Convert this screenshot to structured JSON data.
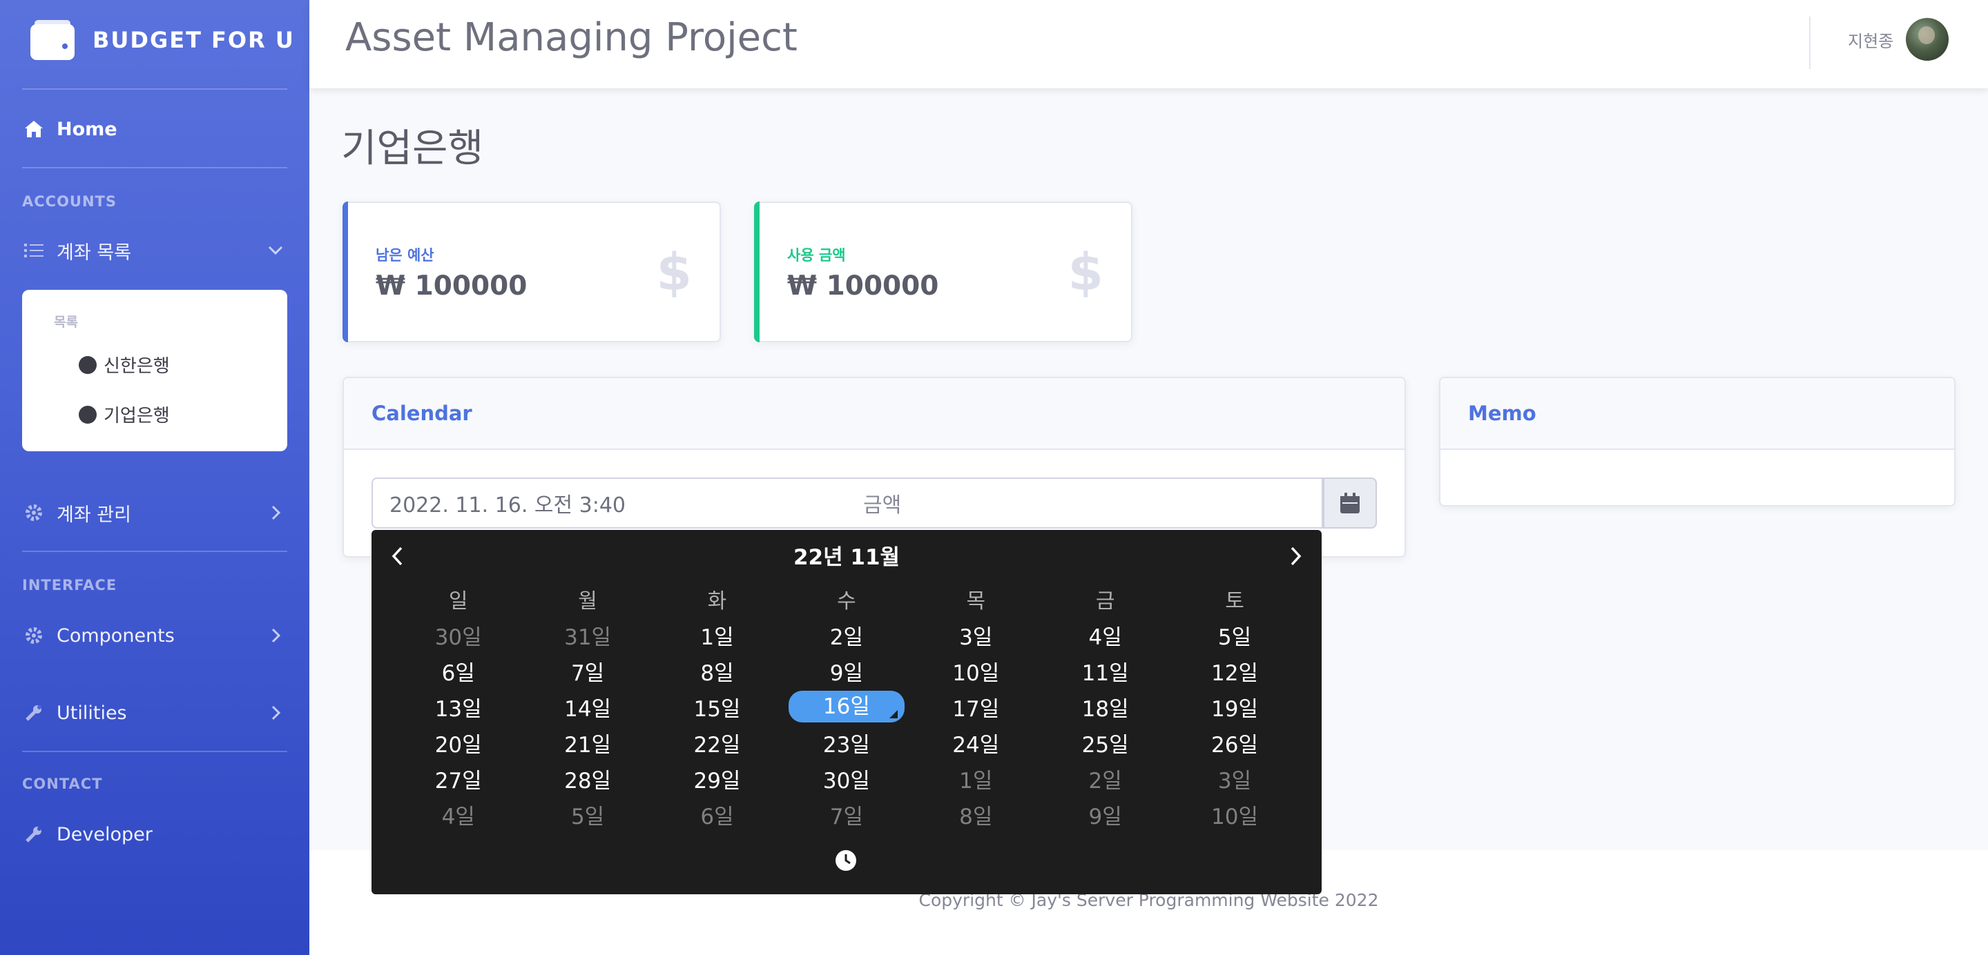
{
  "brand": {
    "name": "BUDGET FOR U"
  },
  "sidebar": {
    "home": "Home",
    "heading_accounts": "ACCOUNTS",
    "account_list": "계좌 목록",
    "submenu": {
      "header": "목록",
      "items": [
        "신한은행",
        "기업은행"
      ]
    },
    "account_manage": "계좌 관리",
    "heading_interface": "INTERFACE",
    "components": "Components",
    "utilities": "Utilities",
    "heading_contact": "CONTACT",
    "developer": "Developer"
  },
  "topbar": {
    "title": "Asset Managing Project",
    "user": "지현종"
  },
  "page": {
    "title": "기업은행"
  },
  "cards": [
    {
      "label": "남은 예산",
      "value": "₩ 100000",
      "color": "#4e73df",
      "icon": "$"
    },
    {
      "label": "사용 금액",
      "value": "₩ 100000",
      "color": "#1cc88a",
      "icon": "$"
    }
  ],
  "calendar": {
    "title": "Calendar",
    "date_value": "2022. 11. 16. 오전 3:40",
    "amount_placeholder": "금액"
  },
  "memo": {
    "title": "Memo"
  },
  "picker": {
    "month_label": "22년 11월",
    "weekdays": [
      "일",
      "월",
      "화",
      "수",
      "목",
      "금",
      "토"
    ],
    "weeks": [
      [
        "30일",
        "31일",
        "1일",
        "2일",
        "3일",
        "4일",
        "5일"
      ],
      [
        "6일",
        "7일",
        "8일",
        "9일",
        "10일",
        "11일",
        "12일"
      ],
      [
        "13일",
        "14일",
        "15일",
        "16일",
        "17일",
        "18일",
        "19일"
      ],
      [
        "20일",
        "21일",
        "22일",
        "23일",
        "24일",
        "25일",
        "26일"
      ],
      [
        "27일",
        "28일",
        "29일",
        "30일",
        "1일",
        "2일",
        "3일"
      ],
      [
        "4일",
        "5일",
        "6일",
        "7일",
        "8일",
        "9일",
        "10일"
      ]
    ],
    "selected_day": "16일",
    "selected_color": "#4e9cf0"
  },
  "footer": {
    "copyright": "Copyright © Jay's Server Programming Website 2022"
  }
}
